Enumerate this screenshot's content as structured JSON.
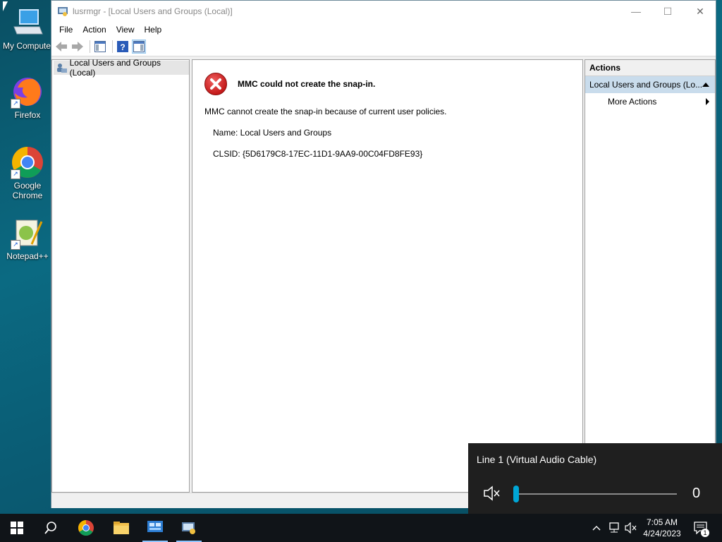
{
  "desktop": {
    "icons": [
      {
        "label": "My Compute"
      },
      {
        "label": "Firefox"
      },
      {
        "label": "Google Chrome"
      },
      {
        "label": "Notepad++"
      }
    ]
  },
  "window": {
    "title": "lusrmgr - [Local Users and Groups (Local)]",
    "controls": {
      "minimize": "—",
      "maximize": "☐",
      "close": "✕"
    },
    "menu": [
      "File",
      "Action",
      "View",
      "Help"
    ],
    "tree": {
      "root_label": "Local Users and Groups (Local)"
    },
    "error": {
      "title": "MMC could not create the snap-in.",
      "message": "MMC cannot create the snap-in because of current user policies.",
      "name_line": "Name: Local Users and Groups",
      "clsid_line": "CLSID: {5D6179C8-17EC-11D1-9AA9-00C04FD8FE93}"
    },
    "actions": {
      "header": "Actions",
      "section": "Local Users and Groups (Lo...",
      "more_actions": "More Actions"
    }
  },
  "volume_flyout": {
    "device": "Line 1 (Virtual Audio Cable)",
    "level": 0,
    "value_text": "0",
    "muted": true
  },
  "taskbar": {
    "clock_time": "7:05 AM",
    "clock_date": "4/24/2023",
    "notification_count": "1",
    "accent_color": "#00a6d6"
  }
}
